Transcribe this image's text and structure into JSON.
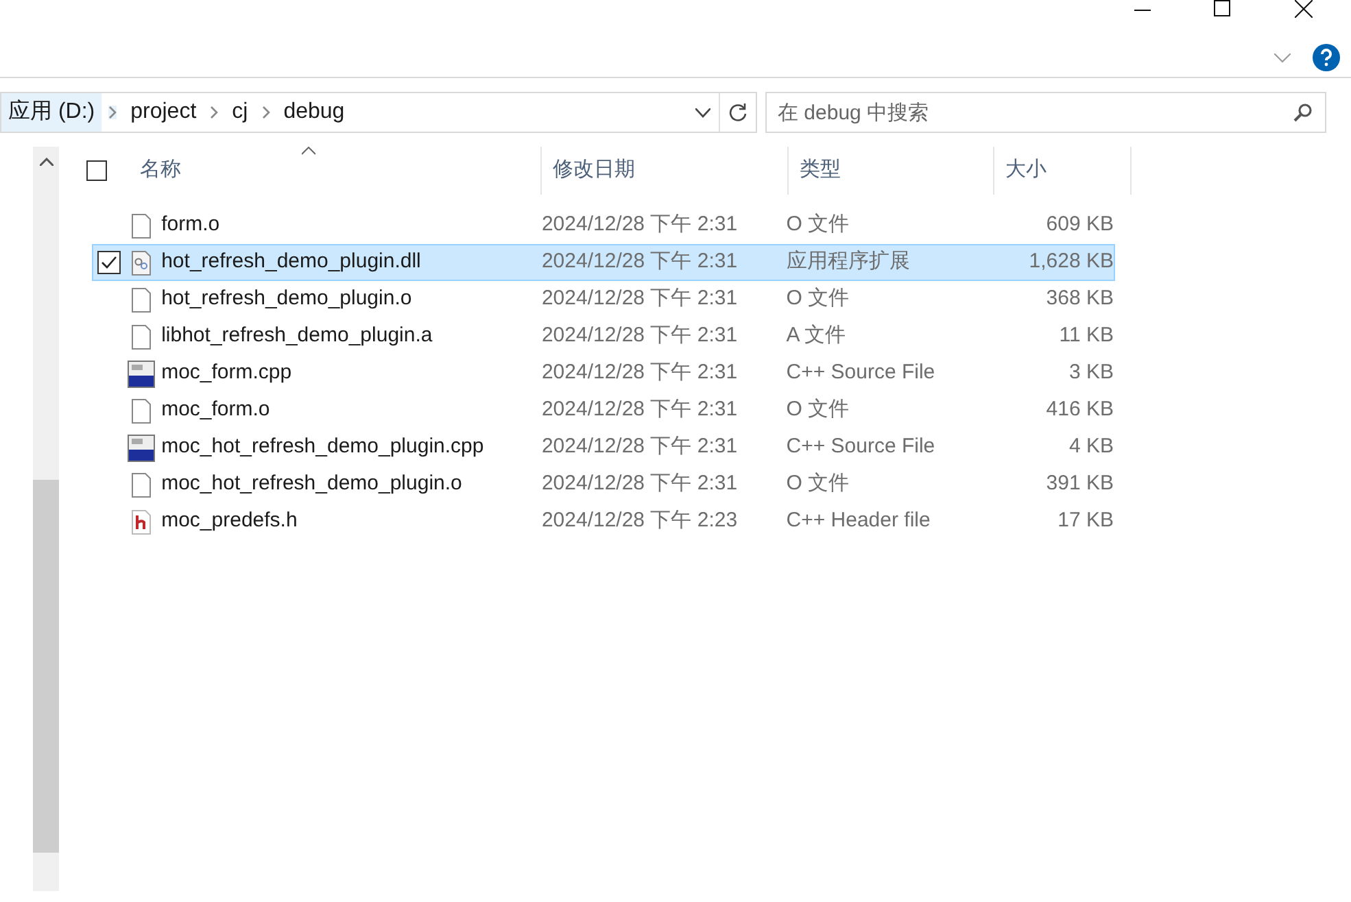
{
  "breadcrumb": [
    {
      "label": "应用 (D:)",
      "selected": true
    },
    {
      "label": "project",
      "selected": false
    },
    {
      "label": "cj",
      "selected": false
    },
    {
      "label": "debug",
      "selected": false
    }
  ],
  "search": {
    "placeholder": "在 debug 中搜索"
  },
  "select_all": {
    "checked": false
  },
  "columns": [
    "名称",
    "修改日期",
    "类型",
    "大小"
  ],
  "files": [
    {
      "name": "form.o",
      "modified": "2024/12/28 下午 2:31",
      "type": "O 文件",
      "size": "609 KB",
      "kind": "blank",
      "selected": false
    },
    {
      "name": "hot_refresh_demo_plugin.dll",
      "modified": "2024/12/28 下午 2:31",
      "type": "应用程序扩展",
      "size": "1,628 KB",
      "kind": "dll",
      "selected": true
    },
    {
      "name": "hot_refresh_demo_plugin.o",
      "modified": "2024/12/28 下午 2:31",
      "type": "O 文件",
      "size": "368 KB",
      "kind": "blank",
      "selected": false
    },
    {
      "name": "libhot_refresh_demo_plugin.a",
      "modified": "2024/12/28 下午 2:31",
      "type": "A 文件",
      "size": "11 KB",
      "kind": "blank",
      "selected": false
    },
    {
      "name": "moc_form.cpp",
      "modified": "2024/12/28 下午 2:31",
      "type": "C++ Source File",
      "size": "3 KB",
      "kind": "cpp",
      "selected": false
    },
    {
      "name": "moc_form.o",
      "modified": "2024/12/28 下午 2:31",
      "type": "O 文件",
      "size": "416 KB",
      "kind": "blank",
      "selected": false
    },
    {
      "name": "moc_hot_refresh_demo_plugin.cpp",
      "modified": "2024/12/28 下午 2:31",
      "type": "C++ Source File",
      "size": "4 KB",
      "kind": "cpp",
      "selected": false
    },
    {
      "name": "moc_hot_refresh_demo_plugin.o",
      "modified": "2024/12/28 下午 2:31",
      "type": "O 文件",
      "size": "391 KB",
      "kind": "blank",
      "selected": false
    },
    {
      "name": "moc_predefs.h",
      "modified": "2024/12/28 下午 2:23",
      "type": "C++ Header file",
      "size": "17 KB",
      "kind": "header",
      "selected": false
    }
  ]
}
